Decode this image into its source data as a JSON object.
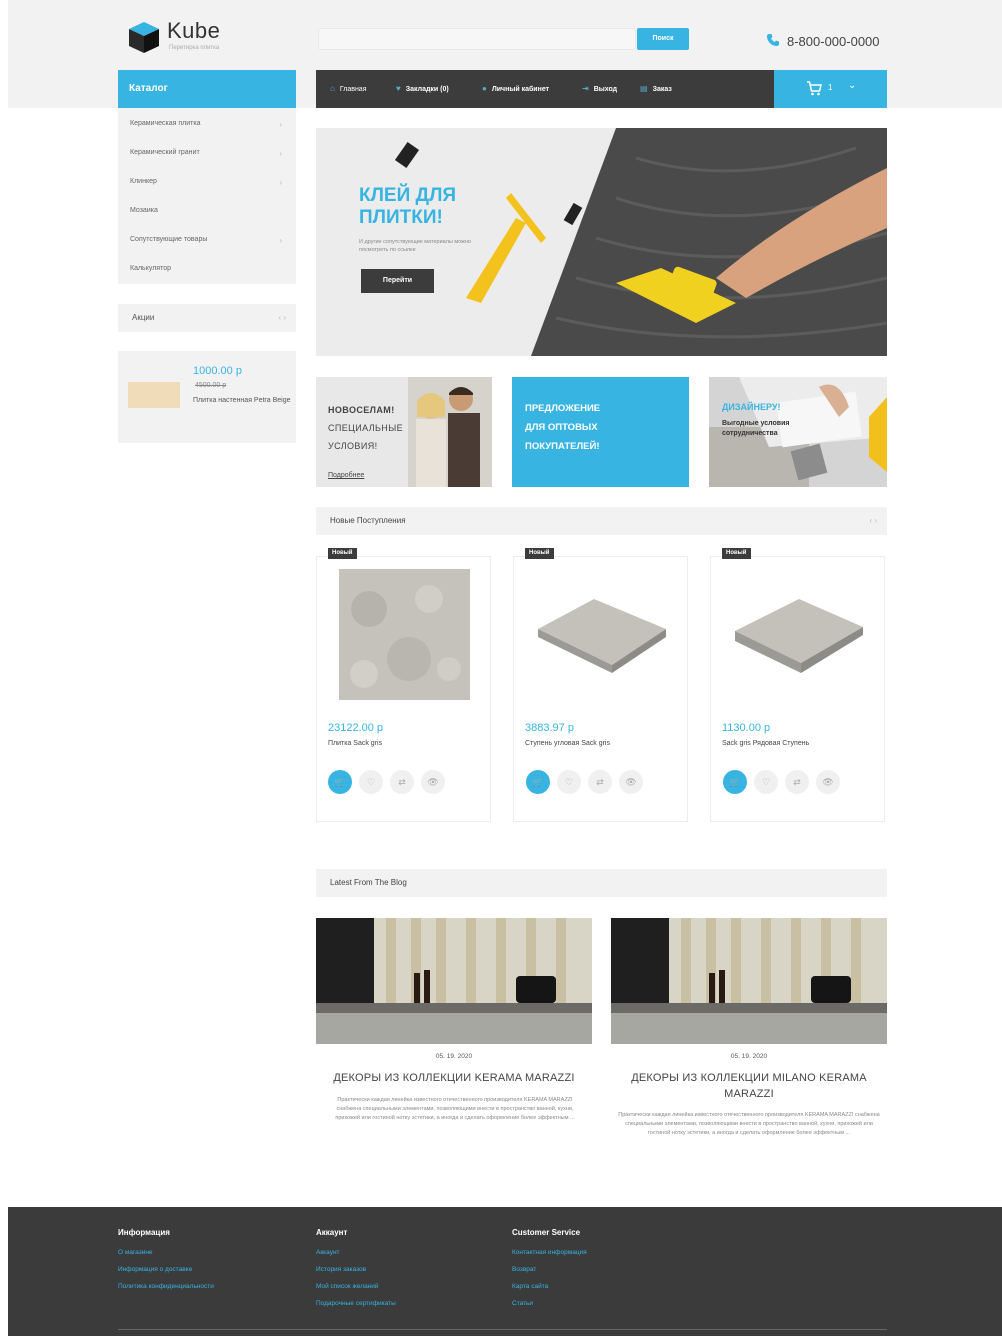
{
  "header": {
    "logo_text": "Kube",
    "logo_tagline": "Перетирка плитка",
    "search": {
      "placeholder": "",
      "button_label": "Поиск"
    },
    "phone": "8-800-000-0000"
  },
  "catalog": {
    "title": "Каталог",
    "items": [
      {
        "label": "Керамическая плитка",
        "has_submenu": true
      },
      {
        "label": "Керамический гранит",
        "has_submenu": true
      },
      {
        "label": "Клинкер",
        "has_submenu": true
      },
      {
        "label": "Мозаика",
        "has_submenu": false
      },
      {
        "label": "Сопутствующие товары",
        "has_submenu": true
      },
      {
        "label": "Калькулятор",
        "has_submenu": false
      }
    ]
  },
  "promo": {
    "title": "Акции",
    "price": "1000.00 р",
    "old_price": "4500.00 р",
    "name": "Плитка настенная Petra Beige"
  },
  "navbar": {
    "items": [
      {
        "label": "Главная",
        "icon": "home-icon"
      },
      {
        "label": "Закладки (0)",
        "icon": "heart-icon"
      },
      {
        "label": "Личный кабинет",
        "icon": "user-icon"
      },
      {
        "label": "Выход",
        "icon": "logout-icon"
      },
      {
        "label": "Заказ",
        "icon": "order-icon"
      }
    ],
    "cart_count": "1"
  },
  "hero": {
    "title": "КЛЕЙ ДЛЯ ПЛИТКИ!",
    "subtitle": "И другие сопутствующие материалы можно посмотреть по ссылке",
    "button_label": "Перейти"
  },
  "banners": {
    "b1": {
      "line1": "НОВОСЕЛАМ!",
      "line2": "СПЕЦИАЛЬНЫЕ",
      "line3": "УСЛОВИЯ!",
      "link": "Подробнее"
    },
    "b2": {
      "line1": "ПРЕДЛОЖЕНИЕ",
      "line2": "ДЛЯ ОПТОВЫХ",
      "line3": "ПОКУПАТЕЛЕЙ!"
    },
    "b3": {
      "title": "ДИЗАЙНЕРУ!",
      "subtitle": "Выгодные условия сотрудничества"
    }
  },
  "new_arrivals": {
    "title": "Новые Поступления",
    "products": [
      {
        "badge": "Новый",
        "price": "23122.00 р",
        "name": "Плитка Sack gris"
      },
      {
        "badge": "Новый",
        "price": "3883.97 р",
        "name": "Ступень угловая Sack gris"
      },
      {
        "badge": "Новый",
        "price": "1130.00 р",
        "name": "Sack gris Рядовая Ступень"
      }
    ]
  },
  "blog": {
    "title": "Latest From The Blog",
    "posts": [
      {
        "date": "05. 19. 2020",
        "title": "ДЕКОРЫ ИЗ КОЛЛЕКЦИИ KERAMA MARAZZI",
        "excerpt": "Практически каждая линейка известного отечественного производителя KERAMA MARAZZI снабжена специальными элементами, позволяющими внести в пространство ванной, кухни, прихожей или гостиной нотку эстетики, а иногда и сделать оформление более эффектным ..."
      },
      {
        "date": "05. 19. 2020",
        "title": "ДЕКОРЫ ИЗ КОЛЛЕКЦИИ MILANO KERAMA MARAZZI",
        "excerpt": "Практически каждая линейка известного отечественного производителя KERAMA MARAZZI снабжена специальными элементами, позволяющими внести в пространство ванной, кухни, прихожей или гостиной нотку эстетики, а иногда и сделать оформление более эффектным ..."
      }
    ]
  },
  "footer": {
    "columns": [
      {
        "title": "Информация",
        "links": [
          "О магазине",
          "Информация о доставке",
          "Политика конфиденциальности"
        ]
      },
      {
        "title": "Аккаунт",
        "links": [
          "Аккаунт",
          "История заказов",
          "Мой список желаний",
          "Подарочные сертификаты"
        ]
      },
      {
        "title": "Customer Service",
        "links": [
          "Контактная информация",
          "Возврат",
          "Карта сайта",
          "Статьи"
        ]
      }
    ]
  },
  "colors": {
    "accent": "#37b4e2",
    "dark": "#3c3c3c",
    "light": "#f2f2f2"
  }
}
